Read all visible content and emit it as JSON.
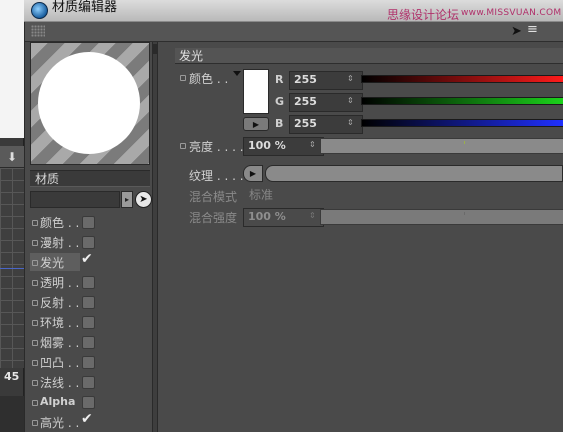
{
  "window": {
    "title": "材质编辑器"
  },
  "watermark": {
    "site_cn": "思缘设计论坛",
    "site_url": "www.MISSVUAN.COM"
  },
  "background_app": {
    "number_label": "45",
    "arrow_glyph": "⬇"
  },
  "material": {
    "name": "材质"
  },
  "channels": [
    {
      "label": "颜色 . .",
      "checked": false
    },
    {
      "label": "漫射 . .",
      "checked": false
    },
    {
      "label": "发光",
      "checked": true,
      "selected": true
    },
    {
      "label": "透明 . .",
      "checked": false
    },
    {
      "label": "反射 . .",
      "checked": false
    },
    {
      "label": "环境 . .",
      "checked": false
    },
    {
      "label": "烟雾 . .",
      "checked": false
    },
    {
      "label": "凹凸 . .",
      "checked": false
    },
    {
      "label": "法线 . .",
      "checked": false
    },
    {
      "label": "Alpha",
      "checked": false
    },
    {
      "label": "高光 . .",
      "checked": true
    }
  ],
  "panel": {
    "section_title": "发光",
    "color_label": "颜色 . .",
    "r_label": "R",
    "g_label": "G",
    "b_label": "B",
    "r_value": "255",
    "g_value": "255",
    "b_value": "255",
    "brightness_label": "亮度 . . . .",
    "brightness_value": "100 %",
    "texture_label": "纹理 . . . .",
    "blend_mode_label": "混合模式",
    "blend_mode_value": "标准",
    "blend_strength_label": "混合强度",
    "blend_strength_value": "100 %"
  },
  "colors": {
    "swatch": "#ffffff",
    "red_slider": "#ff1b1b",
    "green_slider": "#1bd31b",
    "blue_slider": "#2030ff",
    "panel_bg": "#4a4a4a"
  },
  "icons": {
    "picker": "mouse-pointer-icon",
    "spin": "spin-arrows-icon",
    "play": "triangle-right-icon",
    "check": "checkmark-icon"
  }
}
